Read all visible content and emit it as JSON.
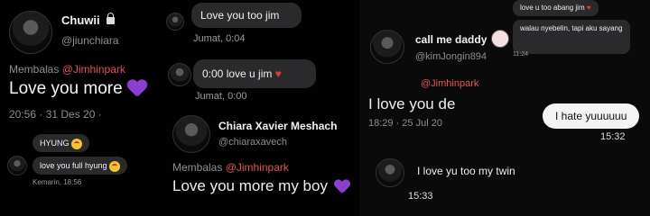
{
  "panel1": {
    "name": "Chuwii",
    "handle": "@jiunchiara",
    "reply_prefix": "Membalas",
    "reply_mention": "@Jimhinpark",
    "tweet": "Love you more",
    "time": "20:56 · 31 Des 20 ·",
    "dm1": "HYUNG",
    "dm2": "love you full hyung",
    "dm_time": "Kemarin, 18:56"
  },
  "panel2": {
    "msg1": "Love you too jim",
    "msg1_time": "Jumat, 0:04",
    "msg2": "0:00 love u jim",
    "msg2_time": "Jumat, 0:00",
    "name": "Chiara Xavier Meshach",
    "handle": "@chiaraxavech",
    "reply_prefix": "Membalas",
    "reply_mention": "@Jimhinpark",
    "tweet": "Love you more my boy"
  },
  "panel3": {
    "top_msg1": "love u too abang jim",
    "top_msg2": "walau nyebelin, tapi aku sayang",
    "top_time": "11:24",
    "name": "call me daddy",
    "handle": "@kimJongin894",
    "reply_mention": "@Jimhinpark",
    "tweet": "I love you de",
    "tweet_time": "18:29 · 25 Jul 20",
    "sent_msg": "I hate yuuuuuu",
    "sent_time": "15:32",
    "recv_msg": "I love yu too my twin",
    "recv_time": "15:33"
  },
  "colors": {
    "mention": "#e0525a",
    "heart_purple": "#8a3fd1",
    "heart_red": "#e23b3b",
    "bubble_dark": "#2a2a2c"
  },
  "icons": [
    "lock-icon",
    "purple-heart-icon",
    "red-heart-icon",
    "heart-eyes-emoji"
  ]
}
